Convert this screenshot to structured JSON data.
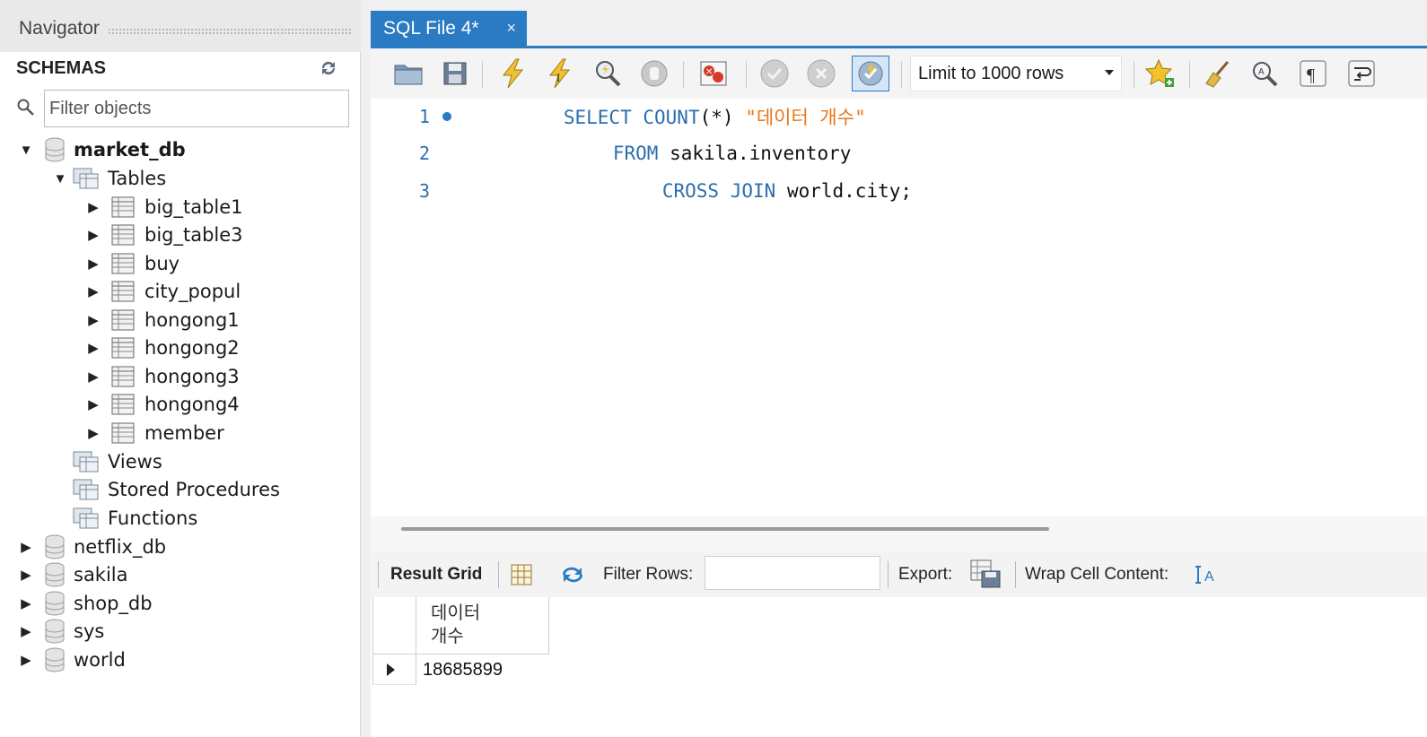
{
  "navigator": {
    "title": "Navigator",
    "schemas_label": "SCHEMAS",
    "filter_placeholder": "Filter objects",
    "databases": [
      {
        "name": "market_db",
        "expanded": true
      },
      {
        "name": "netflix_db"
      },
      {
        "name": "sakila"
      },
      {
        "name": "shop_db"
      },
      {
        "name": "sys"
      },
      {
        "name": "world"
      }
    ],
    "market_db": {
      "tables_label": "Tables",
      "tables": [
        "big_table1",
        "big_table3",
        "buy",
        "city_popul",
        "hongong1",
        "hongong2",
        "hongong3",
        "hongong4",
        "member"
      ],
      "views_label": "Views",
      "procedures_label": "Stored Procedures",
      "functions_label": "Functions"
    }
  },
  "tab": {
    "title": "SQL File 4*",
    "close": "×"
  },
  "toolbar": {
    "limit_value": "Limit to 1000 rows"
  },
  "editor": {
    "lines": [
      {
        "num": "1",
        "tokens": [
          "SELECT",
          "COUNT",
          "(*)",
          "\"데이터 개수\""
        ]
      },
      {
        "num": "2",
        "tokens": [
          "FROM",
          "sakila.inventory"
        ]
      },
      {
        "num": "3",
        "tokens": [
          "CROSS JOIN",
          "world.city;"
        ]
      }
    ]
  },
  "result_toolbar": {
    "result_grid": "Result Grid",
    "filter_rows": "Filter Rows:",
    "export": "Export:",
    "wrap": "Wrap Cell Content:"
  },
  "grid": {
    "column_line1": "데이터",
    "column_line2": "개수",
    "value": "18685899"
  },
  "colors": {
    "accent": "#2a7ac4",
    "keyword": "#2b6fae",
    "string": "#e77719"
  }
}
